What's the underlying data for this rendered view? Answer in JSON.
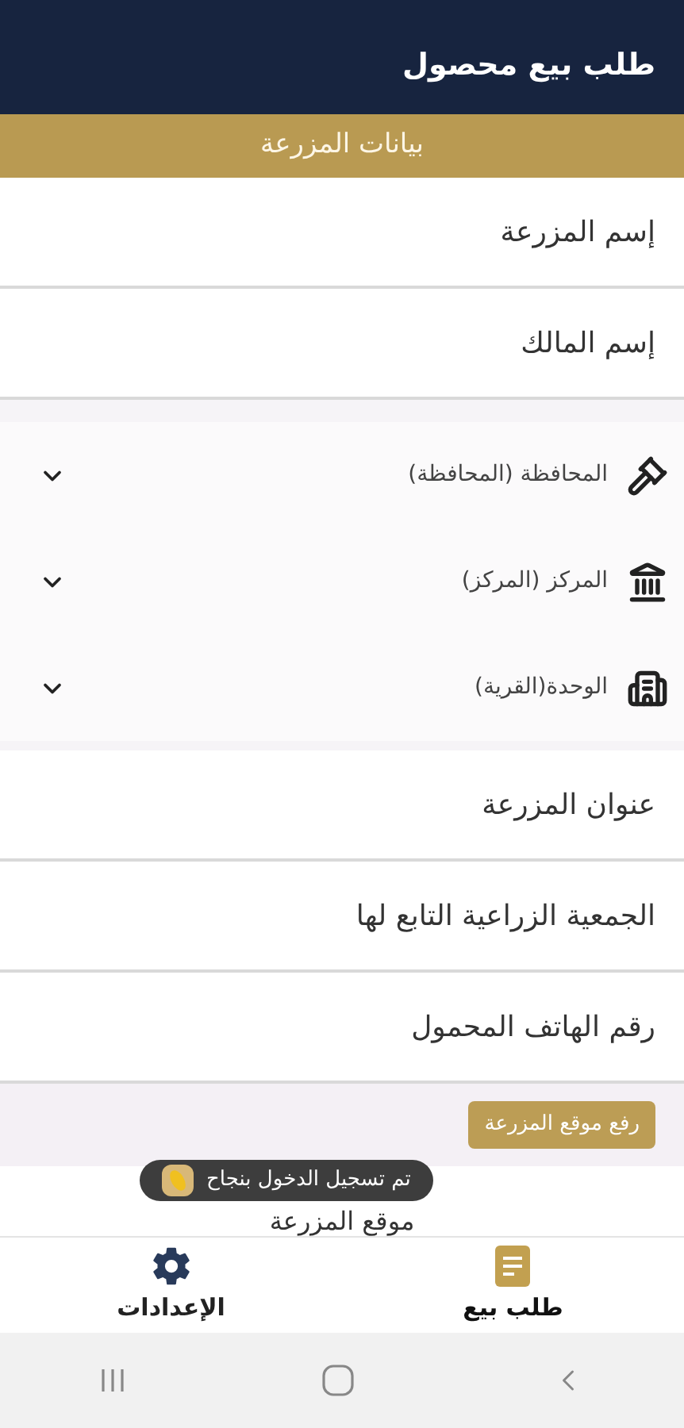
{
  "app_bar": {
    "title": "طلب بيع محصول"
  },
  "section": {
    "title": "بيانات المزرعة"
  },
  "fields_top": [
    {
      "placeholder": "إسم المزرعة"
    },
    {
      "placeholder": "إسم المالك"
    }
  ],
  "dropdowns": [
    {
      "label": "المحافظة (المحافظة)",
      "kind": "gavel"
    },
    {
      "label": "المركز (المركز)",
      "kind": "landmark"
    },
    {
      "label": "الوحدة(القرية)",
      "kind": "building"
    }
  ],
  "fields_bottom": [
    {
      "placeholder": "عنوان المزرعة"
    },
    {
      "placeholder": "الجمعية الزراعية التابع لها"
    },
    {
      "placeholder": "رقم الهاتف المحمول"
    }
  ],
  "upload_button": "رفع موقع المزرعة",
  "location_label": "موقع المزرعة",
  "toast": {
    "message": "تم تسجيل الدخول بنجاح"
  },
  "bottom_nav": [
    {
      "label": "طلب بيع",
      "kind": "request",
      "selected": true
    },
    {
      "label": "الإعدادات",
      "kind": "settings",
      "selected": false
    }
  ]
}
